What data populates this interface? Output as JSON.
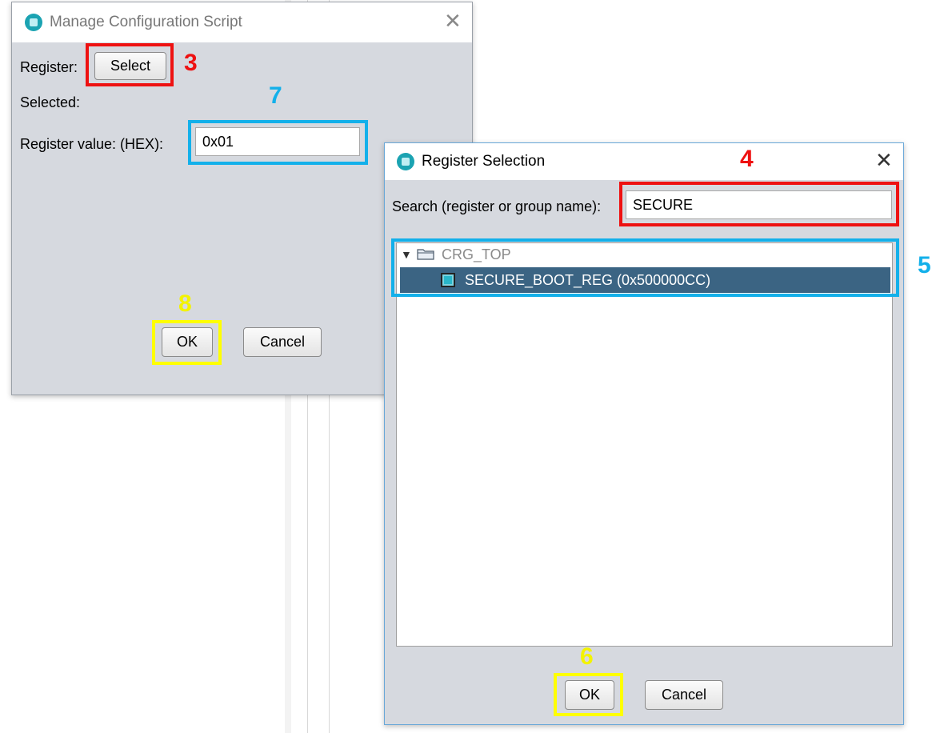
{
  "manage_dialog": {
    "title": "Manage Configuration Script",
    "close_glyph": "✕",
    "register_label": "Register:",
    "select_button": "Select",
    "selected_label": "Selected:",
    "register_value_label": "Register value: (HEX):",
    "register_value": "0x01",
    "ok_button": "OK",
    "cancel_button": "Cancel"
  },
  "register_selection_dialog": {
    "title": "Register Selection",
    "close_glyph": "✕",
    "search_label": "Search (register or group name):",
    "search_value": "SECURE",
    "tree": {
      "group": {
        "expander": "▼",
        "label": "CRG_TOP"
      },
      "item": {
        "label": "SECURE_BOOT_REG (0x500000CC)"
      }
    },
    "ok_button": "OK",
    "cancel_button": "Cancel"
  },
  "annotations": {
    "step_3": "3",
    "step_4": "4",
    "step_5": "5",
    "step_6": "6",
    "step_7": "7",
    "step_8": "8"
  },
  "colors": {
    "annotation_red": "#ee1111",
    "annotation_blue": "#13b0ea",
    "annotation_yellow": "#ffff00",
    "selection": "#3b6483"
  },
  "icons": [
    "app-icon",
    "close-icon",
    "expand-arrow-icon",
    "folder-icon",
    "register-chip-icon"
  ]
}
